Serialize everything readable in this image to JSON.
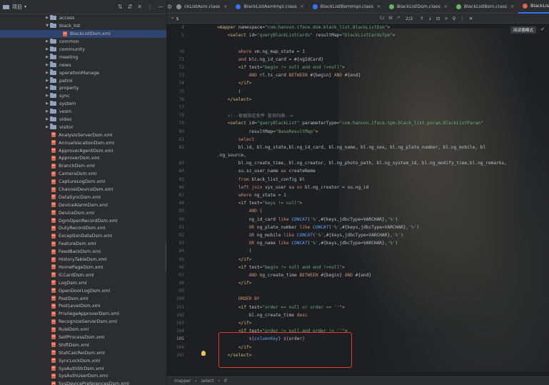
{
  "project": {
    "title": "项目",
    "tree": [
      {
        "label": "access",
        "type": "folder",
        "depth": 1,
        "arrow": "▶"
      },
      {
        "label": "black_list",
        "type": "folder",
        "depth": 1,
        "arrow": "▼"
      },
      {
        "label": "BlackListDsm.xml",
        "type": "xml",
        "depth": 2,
        "arrow": "",
        "selected": true
      },
      {
        "label": "common",
        "type": "folder",
        "depth": 1,
        "arrow": "▶"
      },
      {
        "label": "community",
        "type": "folder",
        "depth": 1,
        "arrow": "▶"
      },
      {
        "label": "meeting",
        "type": "folder",
        "depth": 1,
        "arrow": "▶"
      },
      {
        "label": "news",
        "type": "folder",
        "depth": 1,
        "arrow": "▶"
      },
      {
        "label": "operationManage",
        "type": "folder",
        "depth": 1,
        "arrow": "▶"
      },
      {
        "label": "patrol",
        "type": "folder",
        "depth": 1,
        "arrow": "▶"
      },
      {
        "label": "property",
        "type": "folder",
        "depth": 1,
        "arrow": "▶"
      },
      {
        "label": "sync",
        "type": "folder",
        "depth": 1,
        "arrow": "▶"
      },
      {
        "label": "system",
        "type": "folder",
        "depth": 1,
        "arrow": "▶"
      },
      {
        "label": "vesm",
        "type": "folder",
        "depth": 1,
        "arrow": "▶"
      },
      {
        "label": "video",
        "type": "folder",
        "depth": 1,
        "arrow": "▶"
      },
      {
        "label": "visitor",
        "type": "folder",
        "depth": 1,
        "arrow": "▶"
      },
      {
        "label": "AnalysisServerDsm.xml",
        "type": "xml",
        "depth": 1,
        "arrow": ""
      },
      {
        "label": "AnnualVacationDsm.xml",
        "type": "xml",
        "depth": 1,
        "arrow": ""
      },
      {
        "label": "ApproverAgentDsm.xml",
        "type": "xml",
        "depth": 1,
        "arrow": ""
      },
      {
        "label": "ApproverDsm.xml",
        "type": "xml",
        "depth": 1,
        "arrow": ""
      },
      {
        "label": "BranchDsm.xml",
        "type": "xml",
        "depth": 1,
        "arrow": ""
      },
      {
        "label": "CameraDsm.xml",
        "type": "xml",
        "depth": 1,
        "arrow": ""
      },
      {
        "label": "CaptureLogDsm.xml",
        "type": "xml",
        "depth": 1,
        "arrow": ""
      },
      {
        "label": "ChannelDeviceDsm.xml",
        "type": "xml",
        "depth": 1,
        "arrow": ""
      },
      {
        "label": "DataSyncDsm.xml",
        "type": "xml",
        "depth": 1,
        "arrow": ""
      },
      {
        "label": "DeviceAlarmDsm.xml",
        "type": "xml",
        "depth": 1,
        "arrow": ""
      },
      {
        "label": "DeviceDsm.xml",
        "type": "xml",
        "depth": 1,
        "arrow": ""
      },
      {
        "label": "DgmOpenRecordDsm.xml",
        "type": "xml",
        "depth": 1,
        "arrow": ""
      },
      {
        "label": "DutyRecordDsm.xml",
        "type": "xml",
        "depth": 1,
        "arrow": ""
      },
      {
        "label": "ExceptionDataDsm.xml",
        "type": "xml",
        "depth": 1,
        "arrow": ""
      },
      {
        "label": "FeatureDsm.xml",
        "type": "xml",
        "depth": 1,
        "arrow": ""
      },
      {
        "label": "FeedBackDsm.xml",
        "type": "xml",
        "depth": 1,
        "arrow": ""
      },
      {
        "label": "HistoryTableDsm.xml",
        "type": "xml",
        "depth": 1,
        "arrow": ""
      },
      {
        "label": "HomePageDsm.xml",
        "type": "xml",
        "depth": 1,
        "arrow": ""
      },
      {
        "label": "ICCardDsm.xml",
        "type": "xml",
        "depth": 1,
        "arrow": ""
      },
      {
        "label": "LogDsm.xml",
        "type": "xml",
        "depth": 1,
        "arrow": ""
      },
      {
        "label": "OpenDoorLogDsm.xml",
        "type": "xml",
        "depth": 1,
        "arrow": ""
      },
      {
        "label": "PostDsm.xml",
        "type": "xml",
        "depth": 1,
        "arrow": ""
      },
      {
        "label": "PostLevelDsm.xml",
        "type": "xml",
        "depth": 1,
        "arrow": ""
      },
      {
        "label": "PrivilegeApproverDsm.xml",
        "type": "xml",
        "depth": 1,
        "arrow": ""
      },
      {
        "label": "RecognizeServerDsm.xml",
        "type": "xml",
        "depth": 1,
        "arrow": ""
      },
      {
        "label": "RuleDsm.xml",
        "type": "xml",
        "depth": 1,
        "arrow": ""
      },
      {
        "label": "SelfProcessDsm.xml",
        "type": "xml",
        "depth": 1,
        "arrow": ""
      },
      {
        "label": "ShiftDsm.xml",
        "type": "xml",
        "depth": 1,
        "arrow": ""
      },
      {
        "label": "StatCalcRelDsm.xml",
        "type": "xml",
        "depth": 1,
        "arrow": ""
      },
      {
        "label": "SyncLockDsm.xml",
        "type": "xml",
        "depth": 1,
        "arrow": ""
      },
      {
        "label": "SysAuthStrDsm.xml",
        "type": "xml",
        "depth": 1,
        "arrow": ""
      },
      {
        "label": "SysAuthUserDsm.xml",
        "type": "xml",
        "depth": 1,
        "arrow": ""
      },
      {
        "label": "SysDevicePreferencesDsm.xml",
        "type": "xml",
        "depth": 1,
        "arrow": ""
      }
    ]
  },
  "tabs": [
    {
      "label": "ckListAsm.class",
      "color": "#8b8e94",
      "active": false
    },
    {
      "label": "BlackListAsmImpl.class",
      "color": "#3574f0",
      "active": false
    },
    {
      "label": "BlackListBsmImpl.class",
      "color": "#3574f0",
      "active": false
    },
    {
      "label": "BlackListDsm.class",
      "color": "#5fb865",
      "active": false
    },
    {
      "label": "BlackListBsm.class",
      "color": "#5fb865",
      "active": false
    },
    {
      "label": "BlackListDsm.xml",
      "color": "#d9654b",
      "active": true
    }
  ],
  "find": {
    "query": "$",
    "match_count": "2/2",
    "opt_case": "Cc",
    "opt_word": "W",
    "opt_regex": ".*"
  },
  "reader_mode": "阅读器模式",
  "code_lines": [
    {
      "n": "4",
      "segs": [
        [
          "tag",
          "<mapper "
        ],
        [
          "attr",
          "namespace="
        ],
        [
          "str",
          "\"com.hanvon.iface.dsm.black_list.BlackListDsm\""
        ],
        [
          "tag",
          ">"
        ]
      ]
    },
    {
      "n": "5",
      "segs": [
        [
          "plain",
          "    "
        ],
        [
          "tag",
          "<select "
        ],
        [
          "attr",
          "id="
        ],
        [
          "str",
          "\"queryBlackListCards\" "
        ],
        [
          "attr",
          "resultMap="
        ],
        [
          "str",
          "\"blackListCardsTpm\""
        ],
        [
          "tag",
          ">"
        ]
      ]
    },
    {
      "n": "",
      "segs": []
    },
    {
      "n": "70",
      "segs": [
        [
          "plain",
          "        "
        ],
        [
          "kw",
          "where "
        ],
        [
          "plain",
          "vm.ng_map_state = 1"
        ]
      ]
    },
    {
      "n": "71",
      "segs": [
        [
          "plain",
          "        "
        ],
        [
          "kw",
          "and "
        ],
        [
          "plain",
          "blc.ng_id_card = #{ngIdCard}"
        ]
      ]
    },
    {
      "n": "72",
      "segs": [
        [
          "plain",
          "        "
        ],
        [
          "tag",
          "<if "
        ],
        [
          "attr",
          "test="
        ],
        [
          "str",
          "\"begin != null and end !=null\""
        ],
        [
          "tag",
          ">"
        ]
      ]
    },
    {
      "n": "73",
      "segs": [
        [
          "plain",
          "            "
        ],
        [
          "kw",
          "AND "
        ],
        [
          "plain",
          "rl.ts_card "
        ],
        [
          "kw",
          "BETWEEN "
        ],
        [
          "plain",
          "#{begin} "
        ],
        [
          "kw",
          "AND "
        ],
        [
          "plain",
          "#{end}"
        ]
      ]
    },
    {
      "n": "74",
      "segs": [
        [
          "plain",
          "        "
        ],
        [
          "tag",
          "</if>"
        ]
      ]
    },
    {
      "n": "75",
      "segs": [
        [
          "plain",
          "        )"
        ]
      ]
    },
    {
      "n": "76",
      "segs": [
        [
          "plain",
          "    "
        ],
        [
          "tag",
          "</select>"
        ]
      ]
    },
    {
      "n": "77",
      "segs": []
    },
    {
      "n": "78",
      "segs": [
        [
          "plain",
          "    "
        ],
        [
          "cmt",
          "<!--根据指定条件 查询列表-->"
        ]
      ]
    },
    {
      "n": "79",
      "segs": [
        [
          "plain",
          "    "
        ],
        [
          "tag",
          "<select "
        ],
        [
          "attr",
          "id="
        ],
        [
          "str",
          "\"queryBlackList\" "
        ],
        [
          "attr",
          "parameterType="
        ],
        [
          "str",
          "\"com.hanvon.iface.tpm.black_list.param.BlackListParam\""
        ]
      ]
    },
    {
      "n": "80",
      "segs": [
        [
          "plain",
          "            "
        ],
        [
          "attr",
          "resultMap="
        ],
        [
          "str",
          "\"BaseResultMap\""
        ],
        [
          "tag",
          ">"
        ]
      ]
    },
    {
      "n": "81",
      "segs": [
        [
          "plain",
          "        "
        ],
        [
          "kw",
          "select"
        ]
      ]
    },
    {
      "n": "82",
      "segs": [
        [
          "plain",
          "        bl.id, bl.ng_state,bl.ng_id_card, bl.ng_name, bl.ng_sex, bl.ng_plate_number, bl.ng_mobile, bl"
        ]
      ]
    },
    {
      "n": "",
      "segs": [
        [
          "plain",
          ".ng_source,"
        ]
      ]
    },
    {
      "n": "83",
      "segs": [
        [
          "plain",
          "        bl.ng_create_time, bl.ng_creator, bl.ng_photo_path, bl.ng_system_id, bl.ng_modify_time,bl.ng_remarks,"
        ]
      ]
    },
    {
      "n": "84",
      "segs": [
        [
          "plain",
          "        su.sz_user_name "
        ],
        [
          "kw",
          "as "
        ],
        [
          "plain",
          "createName"
        ]
      ]
    },
    {
      "n": "85",
      "segs": [
        [
          "plain",
          "        "
        ],
        [
          "kw",
          "from "
        ],
        [
          "plain",
          "black_list_config bl"
        ]
      ]
    },
    {
      "n": "86",
      "segs": [
        [
          "plain",
          "        "
        ],
        [
          "kw",
          "left join "
        ],
        [
          "plain",
          "sys_user su "
        ],
        [
          "kw",
          "on "
        ],
        [
          "plain",
          "bl.ng_creator = su.ng_id"
        ]
      ]
    },
    {
      "n": "87",
      "segs": [
        [
          "plain",
          "        "
        ],
        [
          "kw",
          "where "
        ],
        [
          "plain",
          "ng_state = 1"
        ]
      ]
    },
    {
      "n": "88",
      "segs": [
        [
          "plain",
          "        "
        ],
        [
          "tag",
          "<if "
        ],
        [
          "attr",
          "test="
        ],
        [
          "str",
          "\"keys != null\""
        ],
        [
          "tag",
          ">"
        ]
      ]
    },
    {
      "n": "89",
      "segs": [
        [
          "plain",
          "            "
        ],
        [
          "kw",
          "AND "
        ],
        [
          "plain",
          "("
        ]
      ]
    },
    {
      "n": "90",
      "segs": [
        [
          "plain",
          "            ng_id_card "
        ],
        [
          "kw",
          "like "
        ],
        [
          "fn",
          "CONCAT"
        ],
        [
          "plain",
          "("
        ],
        [
          "str",
          "'%'"
        ],
        [
          "plain",
          ",#{keys,jdbcType=VARCHAR},"
        ],
        [
          "str",
          "'%'"
        ],
        [
          "plain",
          ")"
        ]
      ]
    },
    {
      "n": "91",
      "segs": [
        [
          "plain",
          "            "
        ],
        [
          "kw",
          "OR "
        ],
        [
          "plain",
          "ng_plate_number "
        ],
        [
          "kw",
          "like "
        ],
        [
          "fn",
          "CONCAT"
        ],
        [
          "plain",
          "("
        ],
        [
          "str",
          "'%'"
        ],
        [
          "plain",
          ",#{keys,jdbcType=VARCHAR},"
        ],
        [
          "str",
          "'%'"
        ],
        [
          "plain",
          ")"
        ]
      ]
    },
    {
      "n": "92",
      "segs": [
        [
          "plain",
          "            "
        ],
        [
          "kw",
          "OR "
        ],
        [
          "plain",
          "ng_mobile "
        ],
        [
          "kw",
          "like "
        ],
        [
          "fn",
          "CONCAT"
        ],
        [
          "plain",
          "("
        ],
        [
          "str",
          "'%'"
        ],
        [
          "plain",
          ",#{keys,jdbcType=VARCHAR},"
        ],
        [
          "str",
          "'%'"
        ],
        [
          "plain",
          ")"
        ]
      ]
    },
    {
      "n": "93",
      "segs": [
        [
          "plain",
          "            "
        ],
        [
          "kw",
          "OR "
        ],
        [
          "plain",
          "ng_name "
        ],
        [
          "kw",
          "like "
        ],
        [
          "fn",
          "CONCAT"
        ],
        [
          "plain",
          "("
        ],
        [
          "str",
          "'%'"
        ],
        [
          "plain",
          ",#{keys,jdbcType=VARCHAR},"
        ],
        [
          "str",
          "'%'"
        ],
        [
          "plain",
          ")"
        ]
      ]
    },
    {
      "n": "94",
      "segs": [
        [
          "plain",
          "            )"
        ]
      ]
    },
    {
      "n": "95",
      "segs": [
        [
          "plain",
          "        "
        ],
        [
          "tag",
          "</if>"
        ]
      ]
    },
    {
      "n": "96",
      "segs": [
        [
          "plain",
          "        "
        ],
        [
          "tag",
          "<if "
        ],
        [
          "attr",
          "test="
        ],
        [
          "str",
          "\"begin != null and end !=null\""
        ],
        [
          "tag",
          ">"
        ]
      ]
    },
    {
      "n": "97",
      "segs": [
        [
          "plain",
          "            "
        ],
        [
          "kw",
          "AND "
        ],
        [
          "plain",
          "ng_create_time "
        ],
        [
          "kw",
          "BETWEEN "
        ],
        [
          "plain",
          "#{begin} "
        ],
        [
          "kw",
          "AND "
        ],
        [
          "plain",
          "#{end}"
        ]
      ]
    },
    {
      "n": "98",
      "segs": [
        [
          "plain",
          "        "
        ],
        [
          "tag",
          "</if>"
        ]
      ]
    },
    {
      "n": "99",
      "segs": []
    },
    {
      "n": "100",
      "segs": [
        [
          "plain",
          "        "
        ],
        [
          "kw",
          "ORDER BY"
        ]
      ]
    },
    {
      "n": "101",
      "segs": [
        [
          "plain",
          "        "
        ],
        [
          "tag",
          "<if "
        ],
        [
          "attr",
          "test="
        ],
        [
          "str",
          "\"order == null or order == ''\""
        ],
        [
          "tag",
          ">"
        ]
      ]
    },
    {
      "n": "102",
      "segs": [
        [
          "plain",
          "            bl.ng_create_time "
        ],
        [
          "kw",
          "desc"
        ]
      ]
    },
    {
      "n": "103",
      "segs": [
        [
          "plain",
          "        "
        ],
        [
          "tag",
          "</if>"
        ]
      ]
    },
    {
      "n": "104",
      "segs": [
        [
          "plain",
          "        "
        ],
        [
          "tag",
          "<if "
        ],
        [
          "attr",
          "test="
        ],
        [
          "str",
          "\"order != null and order != ''\""
        ],
        [
          "tag",
          ">"
        ]
      ]
    },
    {
      "n": "105",
      "cur": true,
      "segs": [
        [
          "plain",
          "            "
        ],
        [
          "sq",
          "${"
        ],
        [
          "fn",
          "columnKey"
        ],
        [
          "sq",
          "}"
        ],
        [
          "plain",
          " "
        ],
        [
          "sq",
          "${"
        ],
        [
          "plain",
          "order"
        ],
        [
          "sq",
          "}"
        ]
      ]
    },
    {
      "n": "106",
      "segs": [
        [
          "plain",
          "        "
        ],
        [
          "tag",
          "</if>"
        ]
      ]
    },
    {
      "n": "107",
      "segs": [
        [
          "plain",
          "    "
        ],
        [
          "tag",
          "</select>"
        ]
      ]
    }
  ],
  "breadcrumb": [
    "mapper",
    "select",
    "if"
  ]
}
